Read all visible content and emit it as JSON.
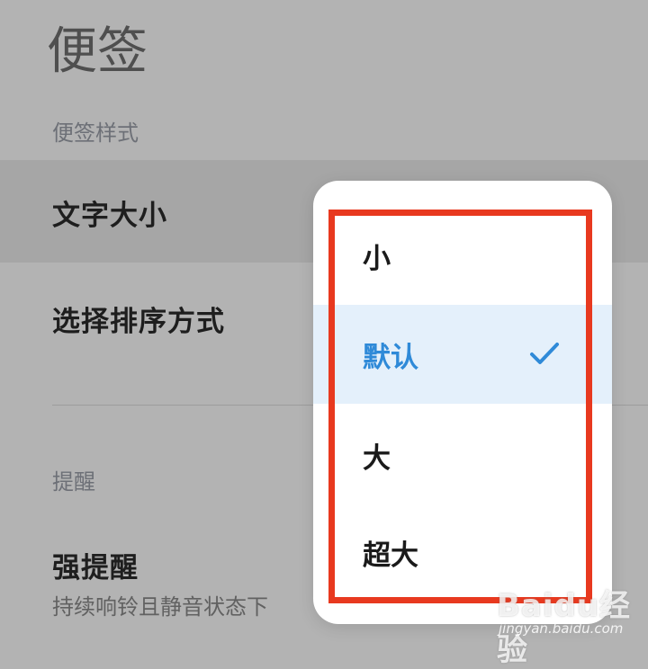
{
  "header": {
    "title": "便签"
  },
  "sections": {
    "style_label": "便签样式",
    "reminder_label": "提醒"
  },
  "rows": {
    "text_size": "文字大小",
    "sort_order": "选择排序方式",
    "strong_reminder": "强提醒",
    "strong_reminder_desc": "持续响铃且静音状态下"
  },
  "popup": {
    "options": [
      "小",
      "默认",
      "大",
      "超大"
    ],
    "selected": "默认",
    "selected_color": "#2f8ad8",
    "highlight_box_color": "#e8391f"
  },
  "watermark": {
    "logo_text": "Baidu经验",
    "url": "jingyan.baidu.com"
  }
}
